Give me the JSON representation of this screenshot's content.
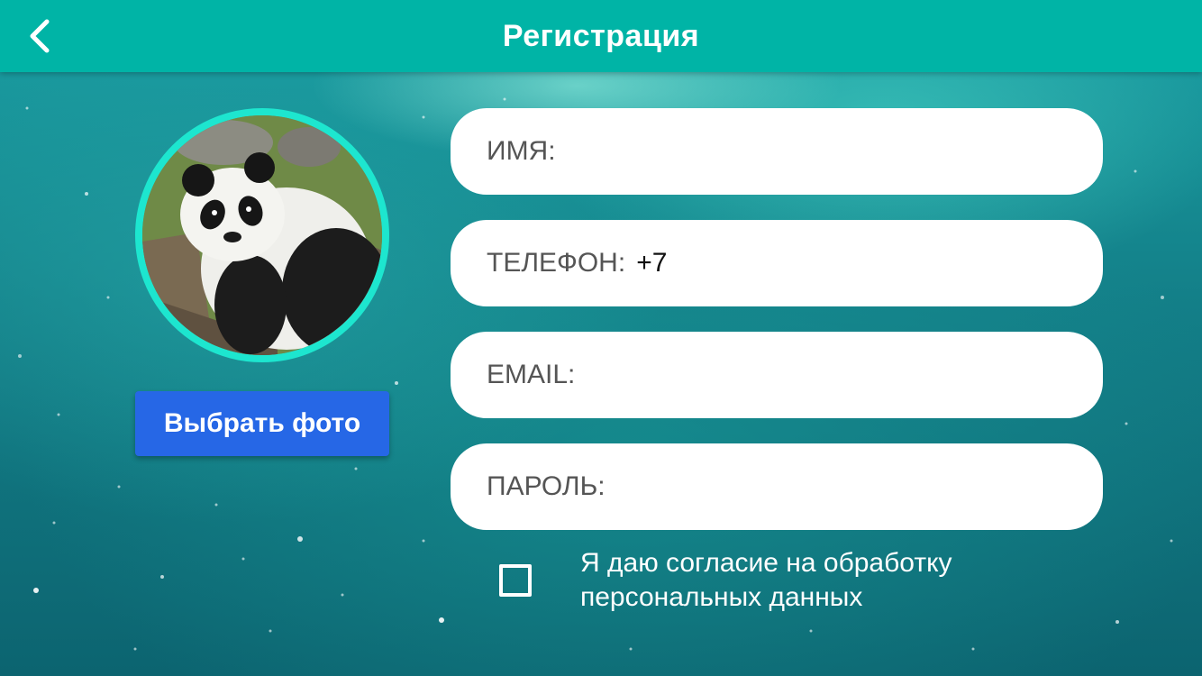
{
  "header": {
    "title": "Регистрация",
    "back_icon": "chevron-left-icon"
  },
  "profile": {
    "photo_alt": "panda",
    "choose_photo_label": "Выбрать фото"
  },
  "form": {
    "name": {
      "label": "ИМЯ:",
      "value": ""
    },
    "phone": {
      "label": "ТЕЛЕФОН:",
      "value": "+7"
    },
    "email": {
      "label": "EMAIL:",
      "value": ""
    },
    "password": {
      "label": "ПАРОЛЬ:",
      "value": ""
    }
  },
  "consent": {
    "checked": false,
    "line1": "Я даю согласие на обработку",
    "line2": "персональных данных"
  },
  "colors": {
    "header": "#00b4a6",
    "accent_ring": "#1de6cf",
    "button": "#2667e6"
  }
}
